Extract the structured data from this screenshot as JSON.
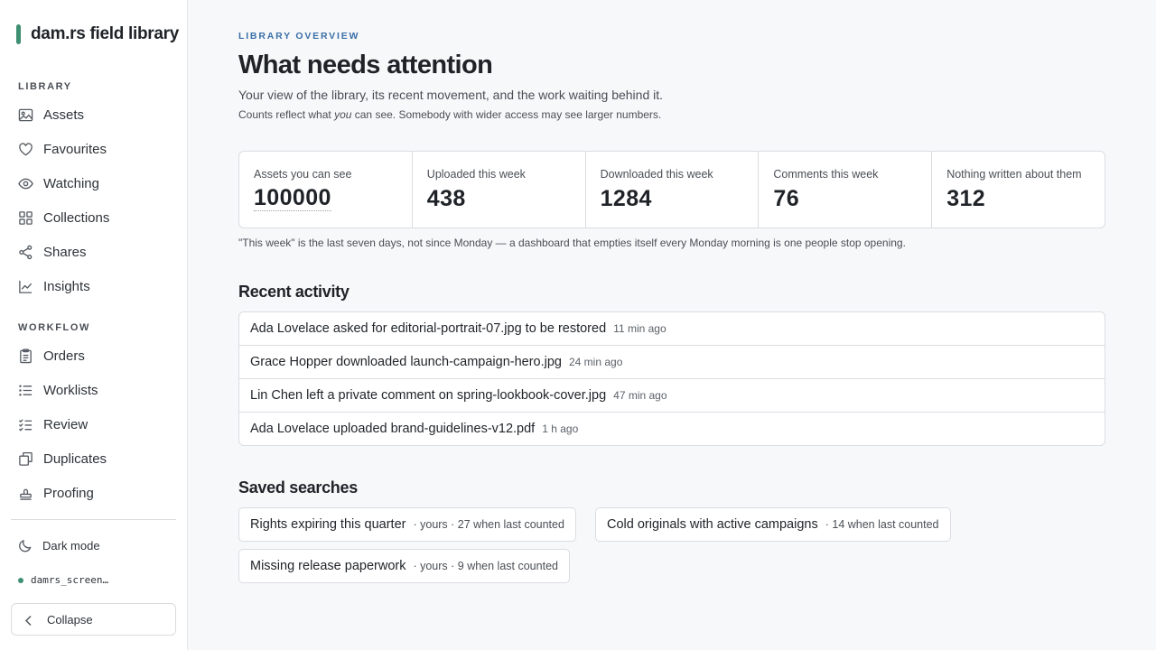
{
  "app": {
    "name": "dam.rs field library",
    "accent": "#3f8f72"
  },
  "sidebar": {
    "sections": [
      {
        "label": "LIBRARY"
      },
      {
        "label": "WORKFLOW"
      }
    ],
    "library_items": [
      {
        "label": "Assets",
        "icon": "image-icon"
      },
      {
        "label": "Favourites",
        "icon": "heart-icon"
      },
      {
        "label": "Watching",
        "icon": "eye-icon"
      },
      {
        "label": "Collections",
        "icon": "grid-icon"
      },
      {
        "label": "Shares",
        "icon": "share-icon"
      },
      {
        "label": "Insights",
        "icon": "line-chart-icon"
      }
    ],
    "workflow_items": [
      {
        "label": "Orders",
        "icon": "clipboard-icon"
      },
      {
        "label": "Worklists",
        "icon": "list-icon"
      },
      {
        "label": "Review",
        "icon": "checklist-icon"
      },
      {
        "label": "Duplicates",
        "icon": "copy-icon"
      },
      {
        "label": "Proofing",
        "icon": "stamp-icon"
      }
    ],
    "dark_mode_label": "Dark mode",
    "user": "damrs_screen…",
    "collapse_label": "Collapse"
  },
  "main": {
    "eyebrow": "LIBRARY OVERVIEW",
    "title": "What needs attention",
    "subtitle": "Your view of the library, its recent movement, and the work waiting behind it.",
    "note_before": "Counts reflect what ",
    "note_em": "you",
    "note_after": " can see. Somebody with wider access may see larger numbers.",
    "stats": [
      {
        "label": "Assets you can see",
        "value": "100000"
      },
      {
        "label": "Uploaded this week",
        "value": "438"
      },
      {
        "label": "Downloaded this week",
        "value": "1284"
      },
      {
        "label": "Comments this week",
        "value": "76"
      },
      {
        "label": "Nothing written about them",
        "value": "312"
      }
    ],
    "stats_footnote": "\"This week\" is the last seven days, not since Monday — a dashboard that empties itself every Monday morning is one people stop opening.",
    "recent_activity_title": "Recent activity",
    "activity": [
      {
        "text": "Ada Lovelace asked for editorial-portrait-07.jpg to be restored",
        "time": "11 min ago"
      },
      {
        "text": "Grace Hopper downloaded launch-campaign-hero.jpg",
        "time": "24 min ago"
      },
      {
        "text": "Lin Chen left a private comment on spring-lookbook-cover.jpg",
        "time": "47 min ago"
      },
      {
        "text": "Ada Lovelace uploaded brand-guidelines-v12.pdf",
        "time": "1 h ago"
      }
    ],
    "saved_searches_title": "Saved searches",
    "saved_searches": [
      {
        "name": "Rights expiring this quarter",
        "meta": "· yours · 27 when last counted"
      },
      {
        "name": "Cold originals with active campaigns",
        "meta": "· 14 when last counted"
      },
      {
        "name": "Missing release paperwork",
        "meta": "· yours · 9 when last counted"
      }
    ]
  }
}
